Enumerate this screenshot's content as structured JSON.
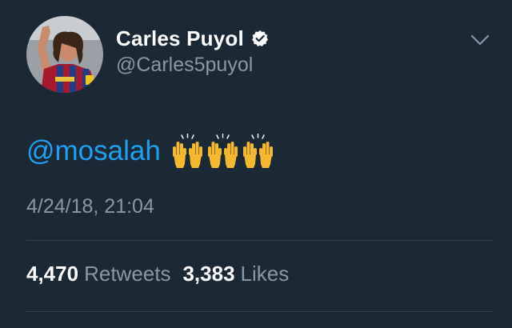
{
  "user": {
    "display_name": "Carles Puyol",
    "handle": "@Carles5puyol",
    "verified": true
  },
  "tweet": {
    "mention": "@mosalah",
    "emoji": [
      "raising-hands",
      "raising-hands",
      "raising-hands"
    ],
    "timestamp": "4/24/18, 21:04"
  },
  "stats": {
    "retweets_count": "4,470",
    "retweets_label": "Retweets",
    "likes_count": "3,383",
    "likes_label": "Likes"
  },
  "colors": {
    "background": "#1b2836",
    "link": "#1da1f2",
    "secondary_text": "#8899a6",
    "divider": "#38444d"
  }
}
